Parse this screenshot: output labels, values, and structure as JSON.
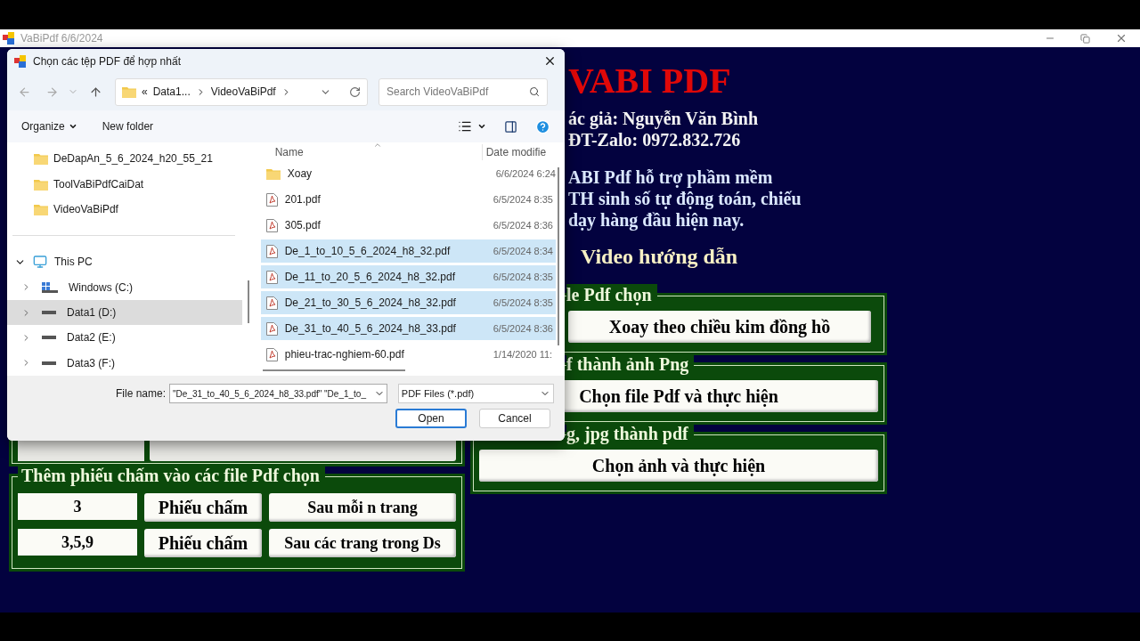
{
  "app": {
    "title": "VaBiPdf 6/6/2024"
  },
  "header": {
    "title": "VABI PDF",
    "author": "ác giả: Nguyễn Văn Bình",
    "phone": "ĐT-Zalo: 0972.832.726",
    "description": [
      "ABI Pdf hỗ trợ phầm mềm",
      "TH sinh số tự động toán, chiếu",
      "dạy hàng đầu hiện nay."
    ],
    "video_link": "Video hướng dẫn"
  },
  "right_groups": [
    {
      "legend": "le Pdf chọn",
      "button": "Xoay theo chiều kim đồng hồ"
    },
    {
      "legend": "f thành ảnh Png",
      "button": "Chọn file Pdf và thực hiện"
    },
    {
      "legend": "g, jpg thành pdf",
      "button": "Chọn ảnh và thực hiện"
    }
  ],
  "answer_sheet_group": {
    "legend": "Thêm phiếu chấm vào các file Pdf chọn",
    "rows": [
      {
        "value": "3",
        "button": "Phiếu chấm",
        "action": "Sau mỗi n trang"
      },
      {
        "value": "3,5,9",
        "button": "Phiếu chấm",
        "action": "Sau các trang trong Ds"
      }
    ]
  },
  "dialog": {
    "title": "Chọn các tệp PDF để hợp nhất",
    "breadcrumb_overflow": "«",
    "breadcrumb": [
      "Data1...",
      "VideoVaBiPdf"
    ],
    "search": {
      "placeholder": "Search VideoVaBiPdf"
    },
    "toolbar": [
      "Organize",
      "New folder"
    ],
    "quick_access": [
      {
        "label": "DeDapAn_5_6_2024_h20_55_21",
        "selected": false
      },
      {
        "label": "ToolVaBiPdfCaiDat",
        "selected": false
      },
      {
        "label": "VideoVaBiPdf",
        "selected": false
      }
    ],
    "this_pc": {
      "label": "This PC",
      "expanded": true,
      "children": [
        {
          "label": "Windows (C:)",
          "kind": "system",
          "expanded": false,
          "selected": false
        },
        {
          "label": "Data1 (D:)",
          "kind": "drive",
          "expanded": false,
          "selected": true
        },
        {
          "label": "Data2 (E:)",
          "kind": "drive",
          "expanded": false,
          "selected": false
        },
        {
          "label": "Data3 (F:)",
          "kind": "drive",
          "expanded": false,
          "selected": false
        }
      ]
    },
    "columns": [
      "Name",
      "Date modifie"
    ],
    "files": [
      {
        "name": "Xoay",
        "date": "6/6/2024 6:24",
        "kind": "folder",
        "selected": false
      },
      {
        "name": "201.pdf",
        "date": "6/5/2024 8:35",
        "kind": "pdf",
        "selected": false
      },
      {
        "name": "305.pdf",
        "date": "6/5/2024 8:36",
        "kind": "pdf",
        "selected": false
      },
      {
        "name": "De_1_to_10_5_6_2024_h8_32.pdf",
        "date": "6/5/2024 8:34",
        "kind": "pdf",
        "selected": true
      },
      {
        "name": "De_11_to_20_5_6_2024_h8_32.pdf",
        "date": "6/5/2024 8:35",
        "kind": "pdf",
        "selected": true
      },
      {
        "name": "De_21_to_30_5_6_2024_h8_32.pdf",
        "date": "6/5/2024 8:35",
        "kind": "pdf",
        "selected": true
      },
      {
        "name": "De_31_to_40_5_6_2024_h8_33.pdf",
        "date": "6/5/2024 8:36",
        "kind": "pdf",
        "selected": true
      },
      {
        "name": "phieu-trac-nghiem-60.pdf",
        "date": "1/14/2020 11:",
        "kind": "pdf",
        "selected": false
      }
    ],
    "file_name_label": "File name:",
    "file_name": "\"De_31_to_40_5_6_2024_h8_33.pdf\" \"De_1_to_",
    "file_type": "PDF Files (*.pdf)",
    "buttons": [
      "Open",
      "Cancel"
    ]
  }
}
